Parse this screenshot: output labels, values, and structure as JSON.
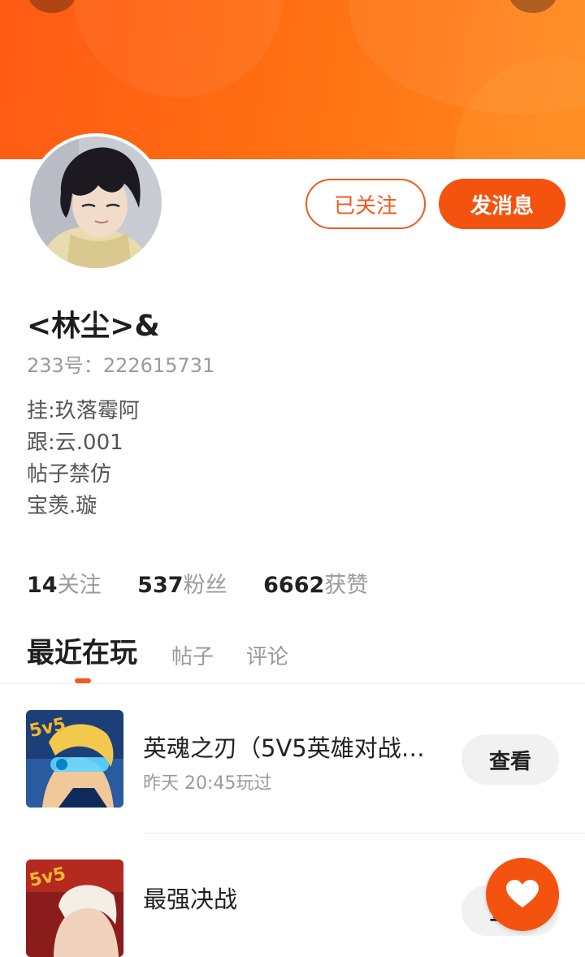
{
  "profile": {
    "nickname": "<林尘>&",
    "id_label": "233号：",
    "id_value": "222615731",
    "bio": [
      "挂:玖落霉阿",
      "跟:云.001",
      "帖子禁仿",
      "宝羡.璇"
    ]
  },
  "actions": {
    "follow_label": "已关注",
    "message_label": "发消息"
  },
  "stats": [
    {
      "num": "14",
      "label": "关注"
    },
    {
      "num": "537",
      "label": "粉丝"
    },
    {
      "num": "6662",
      "label": "获赞"
    }
  ],
  "tabs": [
    {
      "label": "最近在玩",
      "active": true
    },
    {
      "label": "帖子",
      "active": false
    },
    {
      "label": "评论",
      "active": false
    }
  ],
  "games": [
    {
      "title": "英魂之刃（5V5英雄对战…",
      "subtitle": "昨天 20:45玩过",
      "button": "查看",
      "badge": "5v5"
    },
    {
      "title": "最强决战",
      "subtitle": "",
      "button": "查看",
      "badge": "5v5"
    }
  ],
  "colors": {
    "accent": "#f4520f",
    "banner_start": "#ff5a14",
    "banner_end": "#ff8a1e"
  },
  "icons": {
    "fab": "heart-icon"
  }
}
